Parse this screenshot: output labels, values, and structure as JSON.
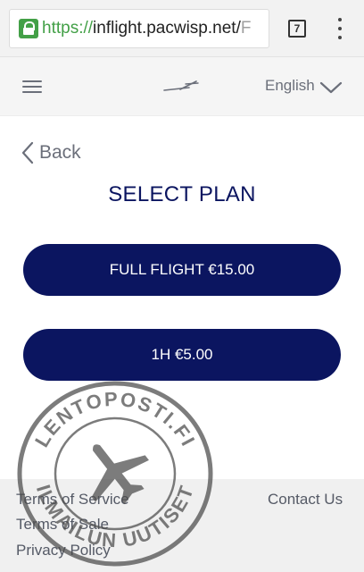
{
  "browser": {
    "url_scheme": "https://",
    "url_host": "inflight.pacwisp.net/",
    "url_tail": "F",
    "tab_count": "7"
  },
  "header": {
    "language": "English"
  },
  "main": {
    "back_label": "Back",
    "title": "SELECT PLAN",
    "plans": [
      {
        "label": "FULL FLIGHT €15.00"
      },
      {
        "label": "1H €5.00"
      }
    ]
  },
  "footer": {
    "terms_of_service": "Terms of Service",
    "terms_of_sale": "Terms of Sale",
    "privacy_policy": "Privacy Policy",
    "contact_us": "Contact Us"
  },
  "watermark": {
    "top_text": "LENTOPOSTI.FI",
    "bottom_text": "ILMAILUN UUTISET"
  },
  "colors": {
    "brand_navy": "#0b1560",
    "secure_green": "#43a047",
    "muted_text": "#6b6f7a"
  }
}
